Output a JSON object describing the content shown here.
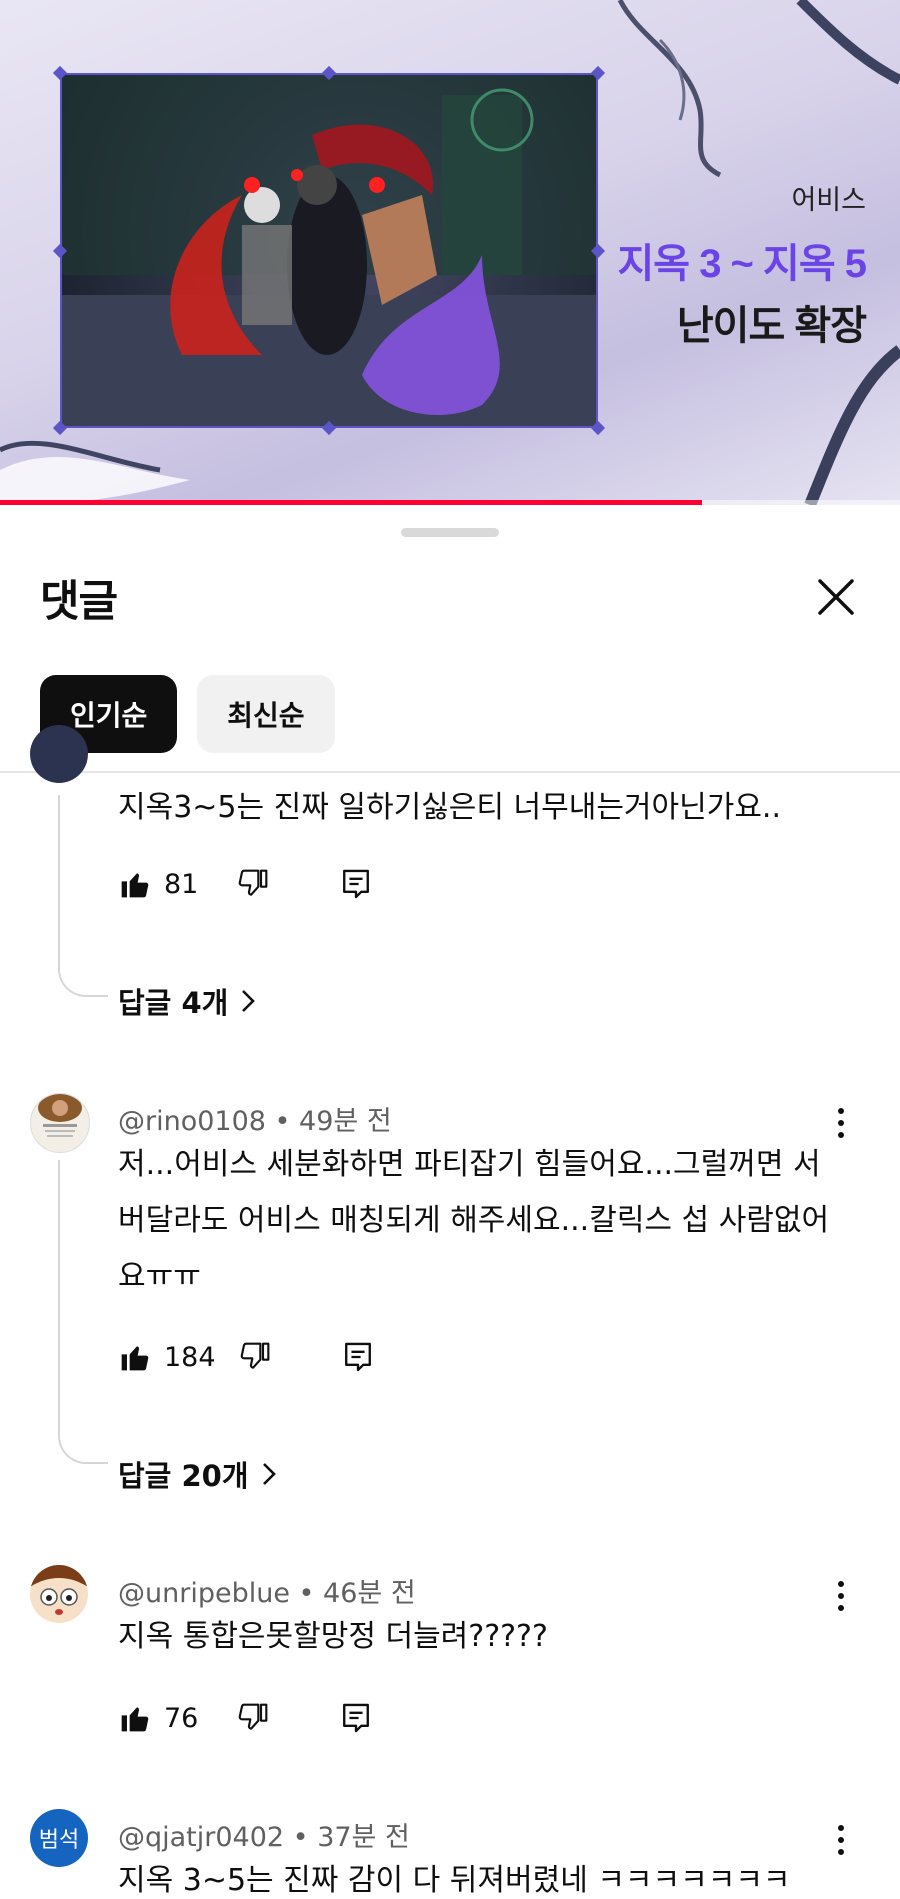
{
  "video": {
    "category": "어비스",
    "title_line1": "지옥 3 ~ 지옥 5",
    "title_line2": "난이도 확장",
    "progress_fraction": 0.78,
    "colors": {
      "accent": "#6a44e6",
      "frame": "#5b55c8",
      "progress": "#ff0033"
    }
  },
  "sheet": {
    "title": "댓글",
    "close_icon": "close-icon",
    "chips": [
      {
        "label": "인기순",
        "active": true
      },
      {
        "label": "최신순",
        "active": false
      }
    ]
  },
  "comments": [
    {
      "text": "지옥3~5는 진짜 일하기싫은티 너무내는거아닌가요..",
      "likes": "81",
      "replies_label": "답글 4개"
    },
    {
      "handle": "@rino0108",
      "time": "49분 전",
      "text": "저...어비스 세분화하면 파티잡기 힘들어요...그럴꺼면 서버달라도 어비스 매칭되게 해주세요...칼릭스 섭 사람없어요ㅠㅠ",
      "likes": "184",
      "replies_label": "답글 20개"
    },
    {
      "handle": "@unripeblue",
      "time": "46분 전",
      "text": "지옥 통합은못할망정 더늘려?????",
      "likes": "76"
    },
    {
      "handle": "@qjatjr0402",
      "time": "37분 전",
      "avatar_text": "범석",
      "text": "지옥 3~5는 진짜 감이 다 뒤져버렸네 ㅋㅋㅋㅋㅋㅋㅋ"
    }
  ],
  "separator": " • "
}
